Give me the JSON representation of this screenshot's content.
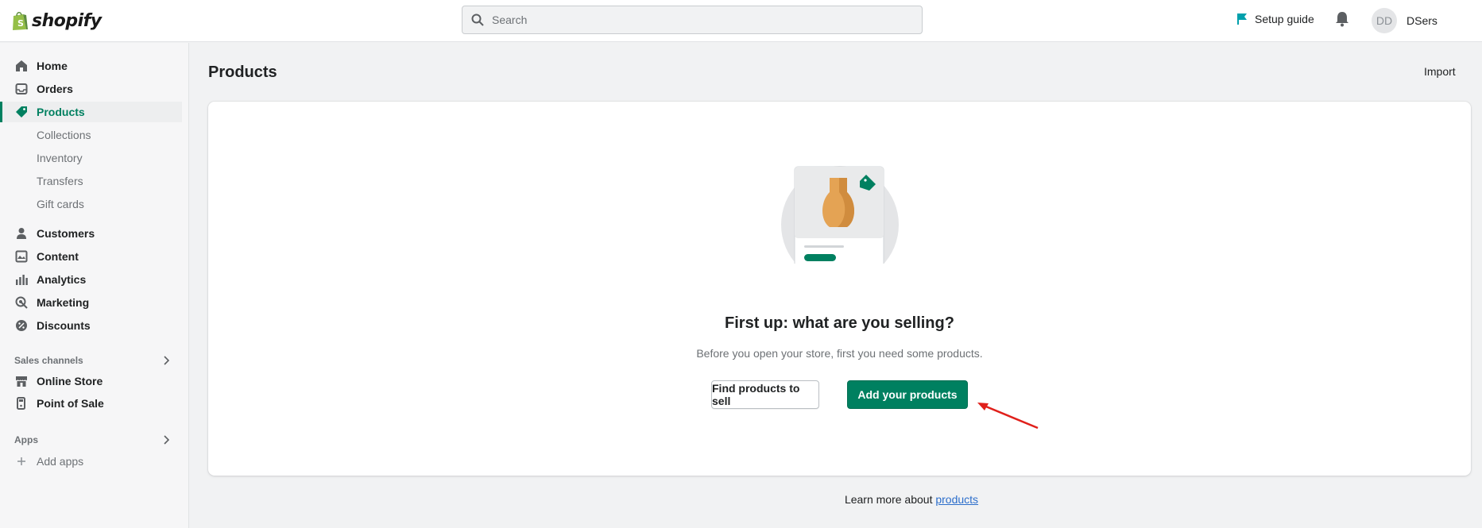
{
  "brand": {
    "name": "shopify",
    "accent": "#008060",
    "logo_bag_color": "#95bf47"
  },
  "topbar": {
    "search_placeholder": "Search",
    "setup_guide": "Setup guide",
    "user": {
      "initials": "DD",
      "name": "DSers"
    }
  },
  "sidebar": {
    "items": [
      {
        "label": "Home",
        "icon": "home-icon"
      },
      {
        "label": "Orders",
        "icon": "orders-icon"
      },
      {
        "label": "Products",
        "icon": "tag-icon",
        "active": true
      },
      {
        "label": "Customers",
        "icon": "person-icon"
      },
      {
        "label": "Content",
        "icon": "content-icon"
      },
      {
        "label": "Analytics",
        "icon": "bar-chart-icon"
      },
      {
        "label": "Marketing",
        "icon": "target-icon"
      },
      {
        "label": "Discounts",
        "icon": "discount-icon"
      }
    ],
    "product_subitems": [
      "Collections",
      "Inventory",
      "Transfers",
      "Gift cards"
    ],
    "sales_channels": {
      "title": "Sales channels",
      "items": [
        {
          "label": "Online Store",
          "icon": "store-icon"
        },
        {
          "label": "Point of Sale",
          "icon": "pos-icon"
        }
      ]
    },
    "apps": {
      "title": "Apps",
      "add_label": "Add apps"
    }
  },
  "main": {
    "title": "Products",
    "import_label": "Import",
    "empty_state": {
      "heading": "First up: what are you selling?",
      "description": "Before you open your store, first you need some products.",
      "secondary_button": "Find products to sell",
      "primary_button": "Add your products"
    },
    "footer": {
      "text": "Learn more about",
      "link": "products"
    }
  }
}
